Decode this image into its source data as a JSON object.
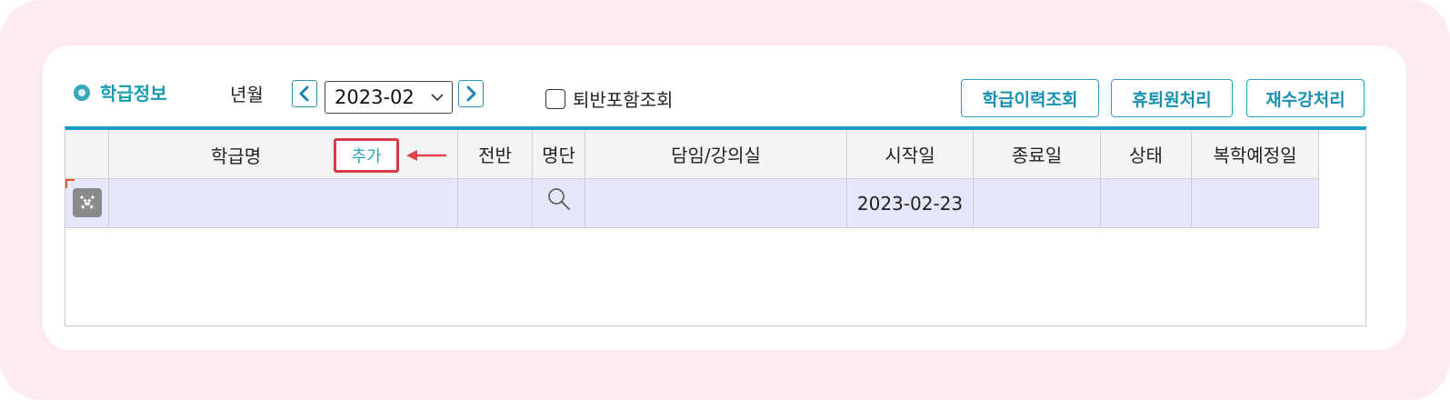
{
  "section": {
    "title": "학급정보",
    "icon": "radio-circle-icon"
  },
  "filter": {
    "year_month_label": "년월",
    "prev_icon": "chevron-left-icon",
    "next_icon": "chevron-right-icon",
    "selected_month": "2023-02",
    "include_withdrawn_label": "퇴반포함조회",
    "include_withdrawn_checked": false
  },
  "actions": {
    "class_history": "학급이력조회",
    "leave_return": "휴퇴원처리",
    "repeat_course": "재수강처리"
  },
  "grid": {
    "columns": [
      "학급명",
      "전반",
      "명단",
      "담임/강의실",
      "시작일",
      "종료일",
      "상태",
      "복학예정일"
    ],
    "add_label": "추가",
    "rows": [
      {
        "class_name": "",
        "prev_class": "",
        "roster_icon": "magnifier-icon",
        "teacher_room": "",
        "start_date": "2023-02-23",
        "end_date": "",
        "status": "",
        "return_date": ""
      }
    ]
  },
  "colors": {
    "accent": "#1a9cc8",
    "highlight": "#d63a44",
    "row_bg": "#e6e6fa"
  }
}
